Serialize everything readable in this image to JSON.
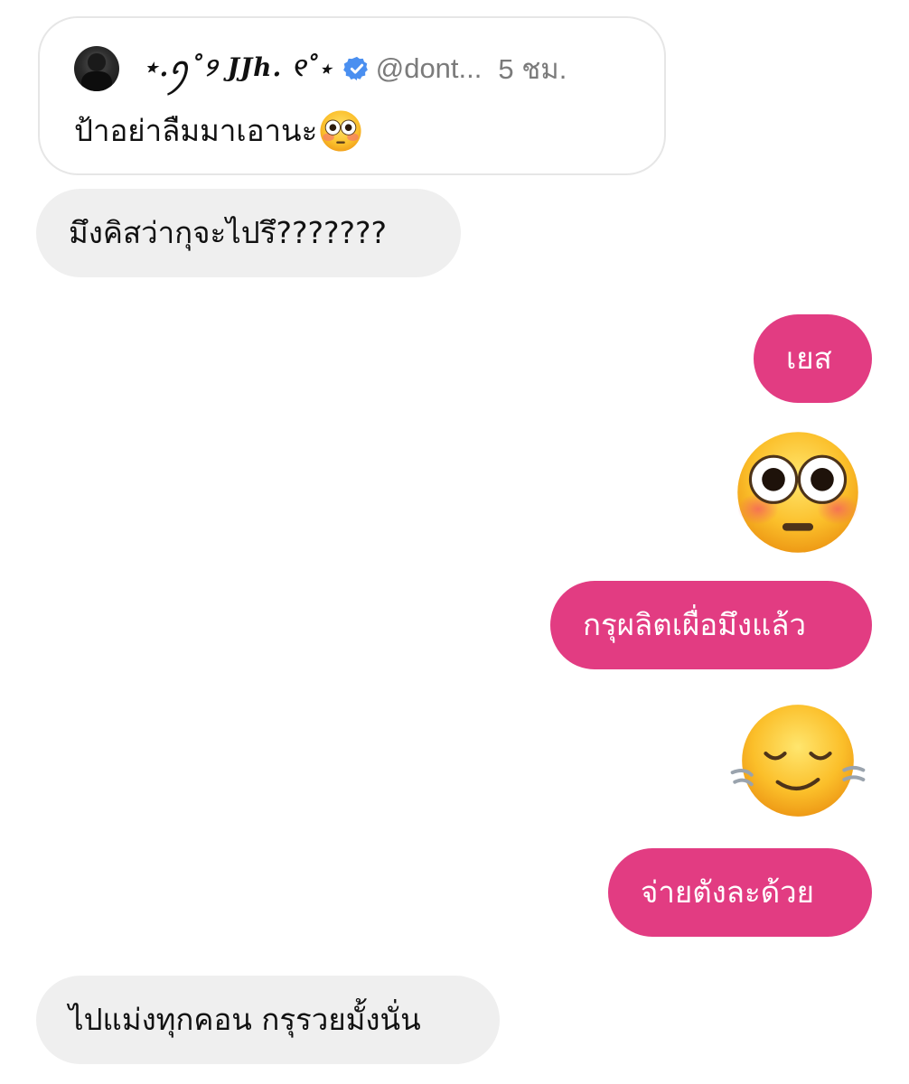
{
  "quote": {
    "display_name": "⋆.ꪆ˚୨ JJh. ୧˚⋆",
    "handle": "@dont...",
    "time": "5 ชม.",
    "text": "ป้าอย่าลืมมาเอานะ",
    "avatar": "avatar-photo",
    "verified_icon": "verified-badge-icon",
    "text_emoji": "flushed-face-emoji"
  },
  "messages": [
    {
      "direction": "incoming",
      "type": "text",
      "text": "มึงคิสว่ากุจะไปรึ???????"
    },
    {
      "direction": "outgoing",
      "type": "text",
      "text": "เยส"
    },
    {
      "direction": "outgoing",
      "type": "emoji",
      "emoji": "flushed-face-emoji"
    },
    {
      "direction": "outgoing",
      "type": "text",
      "text": "กรุผลิตเผื่อมึงแล้ว"
    },
    {
      "direction": "outgoing",
      "type": "emoji",
      "emoji": "face-exhaling-emoji"
    },
    {
      "direction": "outgoing",
      "type": "text",
      "text": "จ่ายตังละด้วย"
    },
    {
      "direction": "incoming",
      "type": "text",
      "text": "ไปแม่งทุกคอน กรุรวยมั้งนั่น"
    }
  ],
  "colors": {
    "outgoing_bubble": "#e23c82",
    "incoming_bubble": "#efefef",
    "verified": "#4a8ff0",
    "meta_text": "#7b7b7b"
  }
}
